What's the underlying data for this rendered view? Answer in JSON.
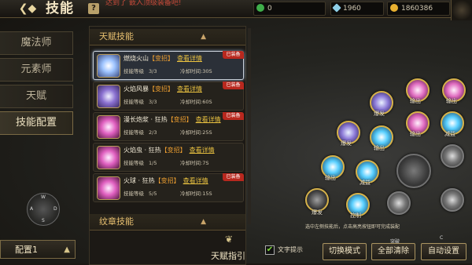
{
  "header": {
    "title": "技能",
    "help": "?",
    "ticker": "达到了   嵌入顶级装备吧!",
    "currencies": [
      {
        "icon": "green-gem-icon",
        "value": "0",
        "color": "#3fae4a"
      },
      {
        "icon": "diamond-icon",
        "value": "1960",
        "color": "#8ed0e8"
      },
      {
        "icon": "gold-coin-icon",
        "value": "1860386",
        "color": "#e8b030"
      }
    ]
  },
  "menu": {
    "tabs": [
      "魔法师",
      "元素师",
      "天赋",
      "技能配置"
    ],
    "active": "技能配置",
    "config_label": "配置1"
  },
  "list": {
    "section_title": "天赋技能",
    "section2_title": "纹章技能",
    "detail_link": "查看详情",
    "level_label": "技能等级",
    "equipped_badge": "已装备",
    "items": [
      {
        "name": "燃烧火山",
        "variant": "【变招】",
        "level": "3/3",
        "cooldown": "冷却时间:30S",
        "equipped": true
      },
      {
        "name": "火焰风暴",
        "variant": "【变招】",
        "level": "3/3",
        "cooldown": "冷却时间:60S",
        "equipped": true
      },
      {
        "name": "漫长炮浆 · 狂热",
        "variant": "【变招】",
        "level": "2/3",
        "cooldown": "冷却时间:25S",
        "equipped": true
      },
      {
        "name": "火焰虫 · 狂热",
        "variant": "【变招】",
        "level": "1/5",
        "cooldown": "冷却时间:7S",
        "equipped": false
      },
      {
        "name": "火球 · 狂热",
        "variant": "【变招】",
        "level": "5/5",
        "cooldown": "冷却时间:15S",
        "equipped": true
      }
    ]
  },
  "tree": {
    "labels": {
      "burst1": "爆发",
      "output1": "输出",
      "output2": "输出",
      "burst2": "爆发",
      "output3": "输出",
      "output4": "输出",
      "reduce1": "减益",
      "output5": "输出",
      "reduce2": "减益",
      "burst3": "爆发",
      "control": "控制"
    },
    "hint_line1": "选中左侧技能后，点击高亮按钮即可完成装配",
    "mark_a": "C",
    "mark_b": "C",
    "mark_c": "突破"
  },
  "footer": {
    "talent_guide": "天赋指引",
    "text_hint_checkbox": "文字提示",
    "text_hint_checked": true,
    "switch_mode": "切换模式",
    "clear_all": "全部清除",
    "auto_setup": "自动设置"
  },
  "colors": {
    "accent_gold": "#d6b24a",
    "equipped_red": "#b8281e",
    "link_yellow": "#e8c040"
  }
}
